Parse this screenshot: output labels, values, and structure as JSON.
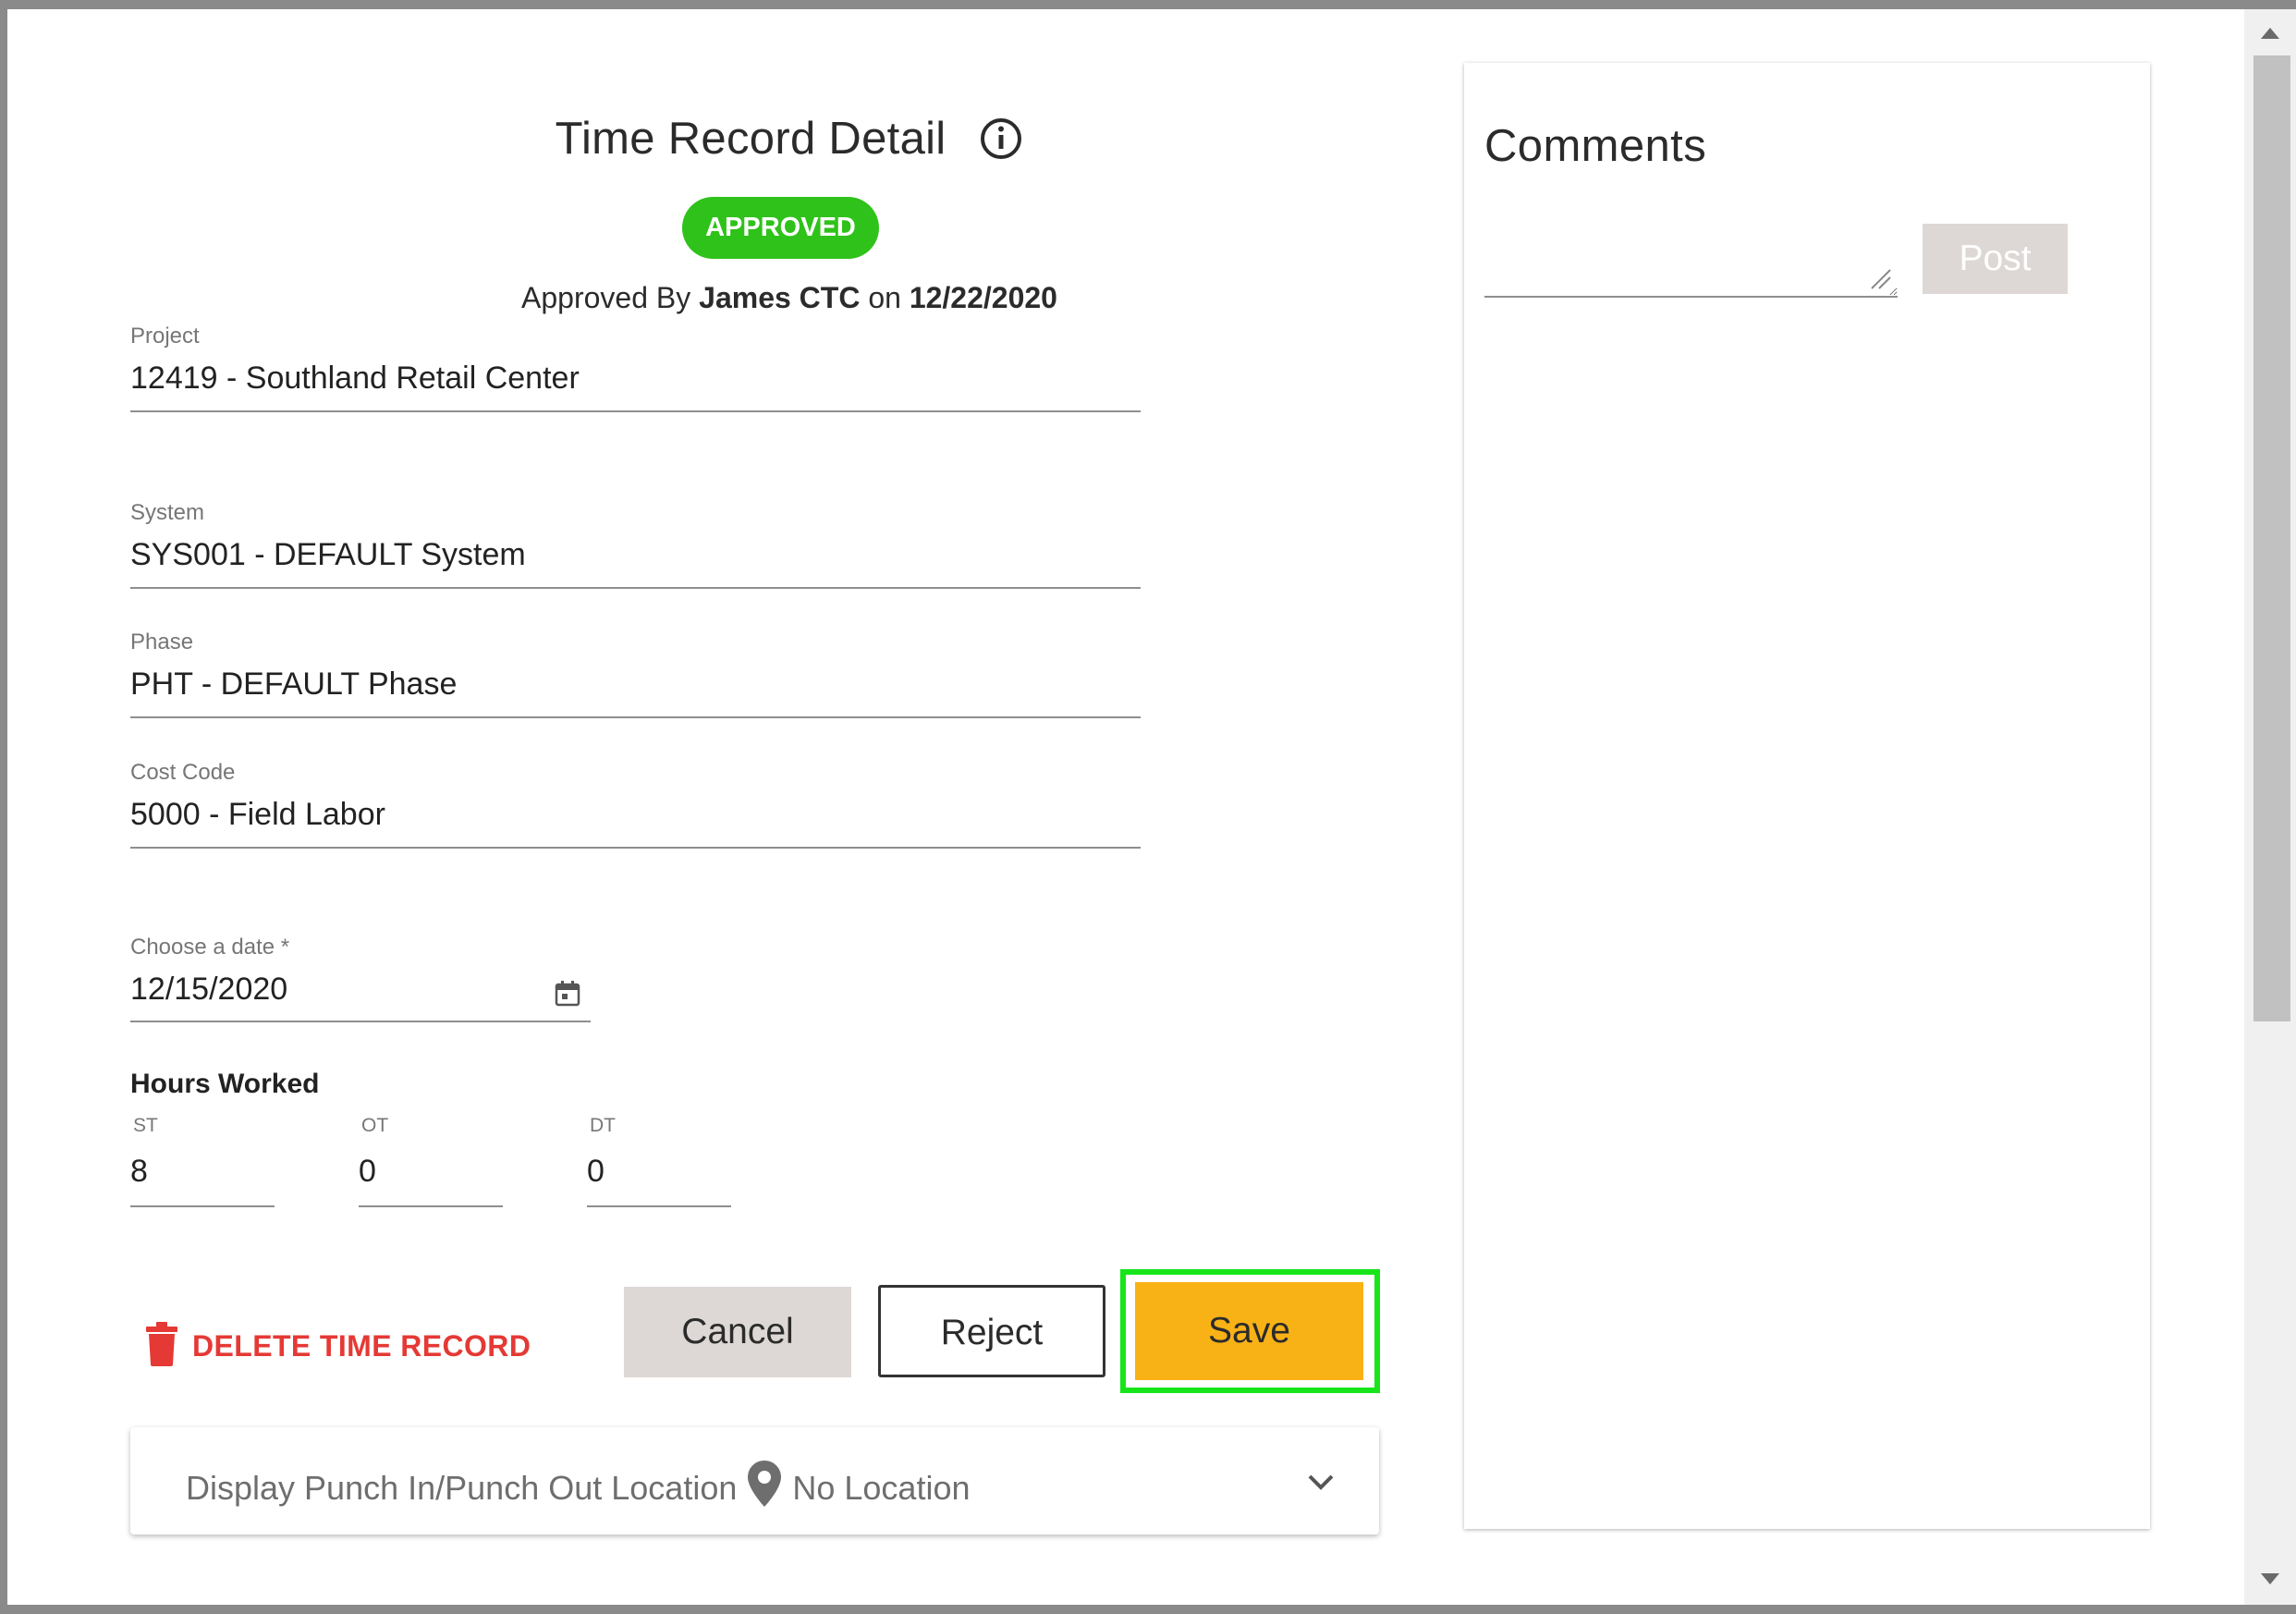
{
  "dialog": {
    "title": "Time Record Detail",
    "status_badge": "APPROVED",
    "approved_by_prefix": "Approved By",
    "approved_by_name": "James CTC",
    "approved_on_word": "on",
    "approved_date": "12/22/2020"
  },
  "fields": {
    "project": {
      "label": "Project",
      "value": "12419 - Southland Retail Center"
    },
    "system": {
      "label": "System",
      "value": "SYS001 - DEFAULT System"
    },
    "phase": {
      "label": "Phase",
      "value": "PHT - DEFAULT Phase"
    },
    "cost_code": {
      "label": "Cost Code",
      "value": "5000 - Field Labor"
    },
    "date": {
      "label": "Choose a date *",
      "value": "12/15/2020"
    }
  },
  "hours": {
    "title": "Hours Worked",
    "st": {
      "label": "ST",
      "value": "8"
    },
    "ot": {
      "label": "OT",
      "value": "0"
    },
    "dt": {
      "label": "DT",
      "value": "0"
    }
  },
  "actions": {
    "delete_label": "DELETE TIME RECORD",
    "cancel_label": "Cancel",
    "reject_label": "Reject",
    "save_label": "Save"
  },
  "location": {
    "label": "Display Punch In/Punch Out Location",
    "value": "No Location"
  },
  "comments": {
    "title": "Comments",
    "input_value": "",
    "post_label": "Post"
  },
  "icons": {
    "info": "info-icon",
    "calendar": "calendar-icon",
    "trash": "trash-icon",
    "location": "location-pin-icon",
    "chevron": "chevron-down-icon"
  },
  "colors": {
    "approved_badge": "#2fc21a",
    "delete_red": "#e53935",
    "save_button": "#f9b216",
    "save_highlight": "#17e51a",
    "neutral_button": "#ddd8d5"
  }
}
